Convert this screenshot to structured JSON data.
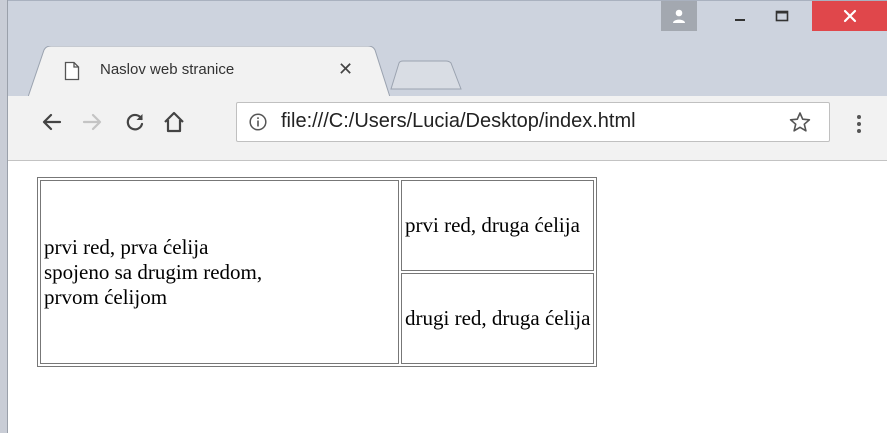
{
  "tab": {
    "title": "Naslov web stranice"
  },
  "address_bar": {
    "url": "file:///C:/Users/Lucia/Desktop/index.html"
  },
  "table": {
    "cell_1_1": [
      "prvi red, prva ćelija",
      "spojeno sa drugim redom,",
      "prvom ćelijom"
    ],
    "cell_1_2": "prvi red, druga ćelija",
    "cell_2_2": "drugi red, druga ćelija"
  },
  "icons": {
    "back": "arrow-left-icon",
    "forward": "arrow-right-icon",
    "reload": "reload-icon",
    "home": "home-icon",
    "info": "info-icon",
    "bookmark": "star-icon",
    "menu": "kebab-menu-icon",
    "profile": "user-icon",
    "minimize": "minimize-icon",
    "maximize": "maximize-icon",
    "close": "close-icon",
    "tab_page": "document-icon"
  },
  "colors": {
    "titlebar": "#cdd3de",
    "close_button": "#e0474b",
    "toolbar": "#f2f2f2"
  }
}
